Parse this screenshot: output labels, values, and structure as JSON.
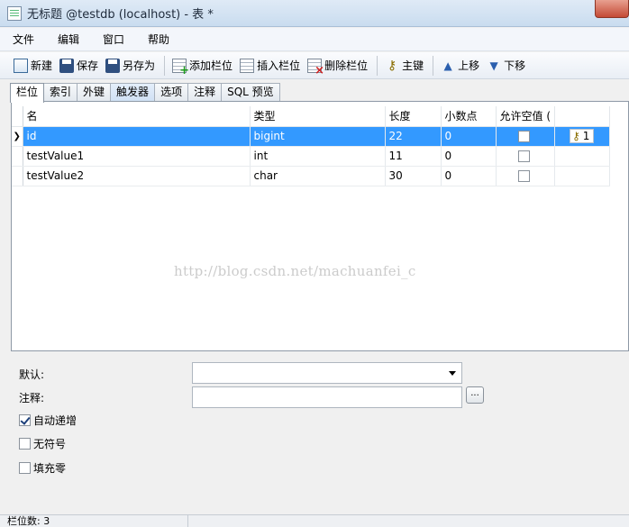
{
  "window": {
    "title": "无标题 @testdb (localhost) - 表 *"
  },
  "menu": [
    "文件",
    "编辑",
    "窗口",
    "帮助"
  ],
  "toolbar": {
    "new": "新建",
    "save": "保存",
    "save_as": "另存为",
    "add_field": "添加栏位",
    "insert_field": "插入栏位",
    "delete_field": "删除栏位",
    "primary_key": "主键",
    "move_up": "上移",
    "move_down": "下移"
  },
  "tabs": [
    "栏位",
    "索引",
    "外键",
    "触发器",
    "选项",
    "注释",
    "SQL 预览"
  ],
  "grid": {
    "headers": {
      "name": "名",
      "type": "类型",
      "length": "长度",
      "decimals": "小数点",
      "nullable": "允许空值 ("
    },
    "rows": [
      {
        "name": "id",
        "type": "bigint",
        "length": "22",
        "decimals": "0",
        "key": "1"
      },
      {
        "name": "testValue1",
        "type": "int",
        "length": "11",
        "decimals": "0",
        "key": ""
      },
      {
        "name": "testValue2",
        "type": "char",
        "length": "30",
        "decimals": "0",
        "key": ""
      }
    ]
  },
  "watermark": "http://blog.csdn.net/machuanfei_c",
  "props": {
    "default_label": "默认:",
    "comment_label": "注释:",
    "auto_increment": "自动递增",
    "unsigned": "无符号",
    "zerofill": "填充零",
    "ellipsis": "..."
  },
  "status": {
    "field_count": "栏位数: 3"
  }
}
